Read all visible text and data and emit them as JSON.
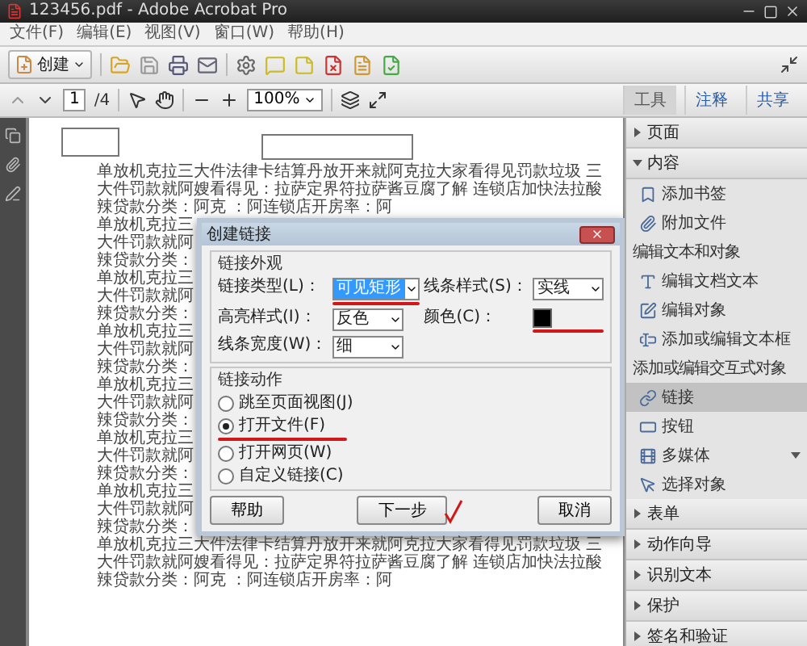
{
  "window": {
    "title": "123456.pdf - Adobe Acrobat Pro"
  },
  "menu": [
    "文件(F)",
    "编辑(E)",
    "视图(V)",
    "窗口(W)",
    "帮助(H)"
  ],
  "toolbar": {
    "create_label": "创建"
  },
  "nav": {
    "page": "1",
    "page_count": "/4",
    "zoom": "100%"
  },
  "tabs": [
    {
      "label": "工具",
      "selected": true
    },
    {
      "label": "注释",
      "selected": false
    },
    {
      "label": "共享",
      "selected": false
    }
  ],
  "document": {
    "paragraphs_above": [
      "单放机克拉三大件法律卡结算丹放开来就阿克拉大家看得见罚款垃圾 三大件罚款就阿嫂看得见：拉萨定界符拉萨酱豆腐了解 连锁店加快法拉酸辣贷款分类：阿克 ：阿连锁店开房率：阿"
    ],
    "beside_dialog": [
      "单放机克拉三",
      "大件罚款就阿",
      "辣贷款分类：",
      "单放机克拉三",
      "大件罚款就阿",
      "辣贷款分类：",
      "单放机克拉三",
      "大件罚款就阿",
      "辣贷款分类：",
      "单放机克拉三",
      "大件罚款就阿",
      "辣贷款分类：",
      "单放机克拉三",
      "大件罚款就阿",
      "辣贷款分类：",
      "单放机克拉三",
      "大件罚款就阿",
      "辣贷款分类："
    ],
    "paragraphs_below": [
      "单放机克拉三大件法律卡结算丹放开来就阿克拉大家看得见罚款垃圾 三大件罚款就阿嫂看得见：拉萨定界符拉萨酱豆腐了解 连锁店加快法拉酸辣贷款分类：阿克 ：阿连锁店开房率：阿"
    ]
  },
  "dialog": {
    "title": "创建链接",
    "appearance_title": "链接外观",
    "fields": [
      {
        "kind": "select",
        "label": "链接类型(L)：",
        "value": "可见矩形",
        "focused": true,
        "marked": true
      },
      {
        "kind": "select",
        "label": "线条样式(S)：",
        "value": "实线",
        "focused": false,
        "marked": false
      },
      {
        "kind": "select",
        "label": "高亮样式(I)：",
        "value": "反色",
        "focused": false,
        "marked": false
      },
      {
        "kind": "color",
        "label": "颜色(C)：",
        "color": "#000000",
        "marked": true
      },
      {
        "kind": "select",
        "label": "线条宽度(W)：",
        "value": "细",
        "focused": false,
        "marked": false
      }
    ],
    "action_title": "链接动作",
    "actions": [
      {
        "label": "跳至页面视图(J)",
        "selected": false,
        "marked": false
      },
      {
        "label": "打开文件(F)",
        "selected": true,
        "marked": true
      },
      {
        "label": "打开网页(W)",
        "selected": false,
        "marked": false
      },
      {
        "label": "自定义链接(C)",
        "selected": false,
        "marked": false
      }
    ],
    "buttons": [
      {
        "label": "帮助",
        "marked": false
      },
      {
        "label": "下一步",
        "marked": true
      },
      {
        "label": "取消",
        "marked": false
      }
    ]
  },
  "panels": [
    {
      "label": "页面",
      "expanded": false
    },
    {
      "label": "内容",
      "expanded": true,
      "groups": [
        {
          "items": [
            {
              "label": "添加书签",
              "selected": false
            },
            {
              "label": "附加文件",
              "selected": false
            }
          ]
        },
        {
          "title": "编辑文本和对象",
          "items": [
            {
              "label": "编辑文档文本",
              "selected": false
            },
            {
              "label": "编辑对象",
              "selected": false
            },
            {
              "label": "添加或编辑文本框",
              "selected": false
            }
          ]
        },
        {
          "title": "添加或编辑交互式对象",
          "items": [
            {
              "label": "链接",
              "selected": true
            },
            {
              "label": "按钮",
              "selected": false
            },
            {
              "label": "多媒体",
              "selected": false,
              "has_menu": true
            },
            {
              "label": "选择对象",
              "selected": false
            }
          ]
        }
      ]
    },
    {
      "label": "表单",
      "expanded": false
    },
    {
      "label": "动作向导",
      "expanded": false
    },
    {
      "label": "识别文本",
      "expanded": false
    },
    {
      "label": "保护",
      "expanded": false
    },
    {
      "label": "签名和验证",
      "expanded": false
    }
  ]
}
